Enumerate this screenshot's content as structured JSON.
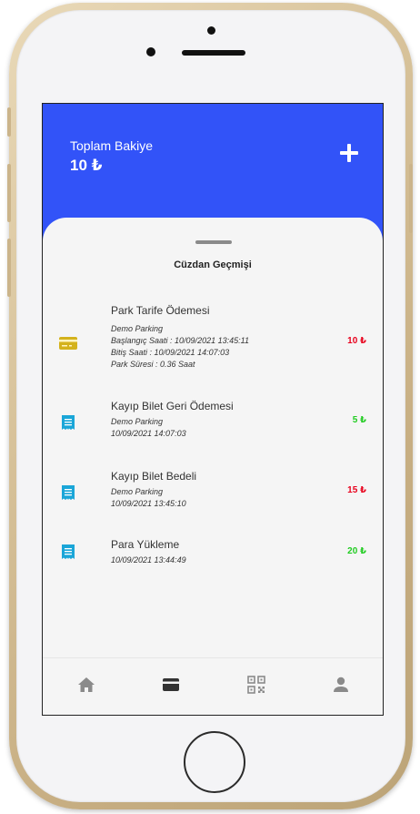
{
  "colors": {
    "header_bg": "#3253f8",
    "debit": "#e8001c",
    "credit": "#22cc22",
    "card_icon": "#d4b21c",
    "receipt_icon": "#1aa6d8",
    "nav_icon": "#8a8a8a",
    "nav_icon_active": "#333333"
  },
  "header": {
    "balance_label": "Toplam Bakiye",
    "balance_value": "10 ₺",
    "add_icon": "plus-icon"
  },
  "sheet": {
    "title": "Cüzdan Geçmişi"
  },
  "transactions": [
    {
      "icon": "card-icon",
      "title": "Park Tarife Ödemesi",
      "lines": [
        "Demo Parking",
        "Başlangıç Saati : 10/09/2021 13:45:11",
        "Bitiş Saati : 10/09/2021 14:07:03",
        "Park Süresi : 0.36 Saat"
      ],
      "amount": "10 ₺",
      "type": "debit"
    },
    {
      "icon": "receipt-icon",
      "title": "Kayıp Bilet Geri Ödemesi",
      "lines": [
        "Demo Parking",
        "10/09/2021 14:07:03"
      ],
      "amount": "5 ₺",
      "type": "credit"
    },
    {
      "icon": "receipt-icon",
      "title": "Kayıp Bilet Bedeli",
      "lines": [
        "Demo Parking",
        "10/09/2021 13:45:10"
      ],
      "amount": "15 ₺",
      "type": "debit"
    },
    {
      "icon": "receipt-icon",
      "title": "Para Yükleme",
      "lines": [
        "10/09/2021 13:44:49"
      ],
      "amount": "20 ₺",
      "type": "credit"
    }
  ],
  "bottom_nav": {
    "items": [
      {
        "icon": "home-icon",
        "active": false
      },
      {
        "icon": "wallet-card-icon",
        "active": true
      },
      {
        "icon": "qr-code-icon",
        "active": false
      },
      {
        "icon": "user-icon",
        "active": false
      }
    ]
  }
}
